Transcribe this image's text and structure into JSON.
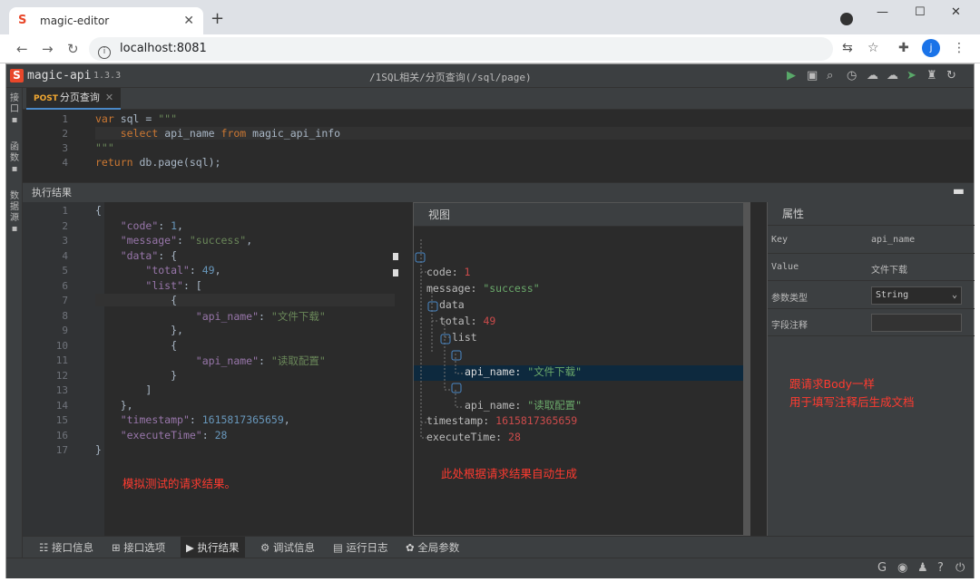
{
  "browser": {
    "tab_title": "magic-editor",
    "url": "localhost:8081"
  },
  "app": {
    "name": "magic-api",
    "version": "1.3.3",
    "path": "/1SQL相关/分页查询(/sql/page)",
    "sidebar": [
      "接口",
      "函数",
      "数据源"
    ],
    "editor_tab": {
      "method": "POST",
      "title": "分页查询"
    },
    "accent_color": "#4a88c7"
  },
  "editor": {
    "line_numbers": [
      "1",
      "2",
      "3",
      "4"
    ]
  },
  "result": {
    "panel_title": "执行结果",
    "line_numbers": [
      "1",
      "2",
      "3",
      "4",
      "5",
      "6",
      "7",
      "8",
      "9",
      "10",
      "11",
      "12",
      "13",
      "14",
      "15",
      "16",
      "17"
    ]
  },
  "view": {
    "title": "视图",
    "code_value": "1",
    "message_value": "\"success\"",
    "total_value": "49",
    "item1": "\"文件下载\"",
    "item2": "\"读取配置\"",
    "timestamp_value": "1615817365659",
    "exec_value": "28"
  },
  "props": {
    "title": "属性",
    "key_label": "Key",
    "key_value": "api_name",
    "value_label": "Value",
    "value_value": "文件下载",
    "type_label": "参数类型",
    "type_value": "String",
    "remark_label": "字段注释"
  },
  "annotations": {
    "result": "模拟测试的请求结果。",
    "view": "此处根据请求结果自动生成",
    "props1": "跟请求Body一样",
    "props2": "用于填写注释后生成文档"
  },
  "bottom_tabs": [
    "接口信息",
    "接口选项",
    "执行结果",
    "调试信息",
    "运行日志",
    "全局参数"
  ]
}
